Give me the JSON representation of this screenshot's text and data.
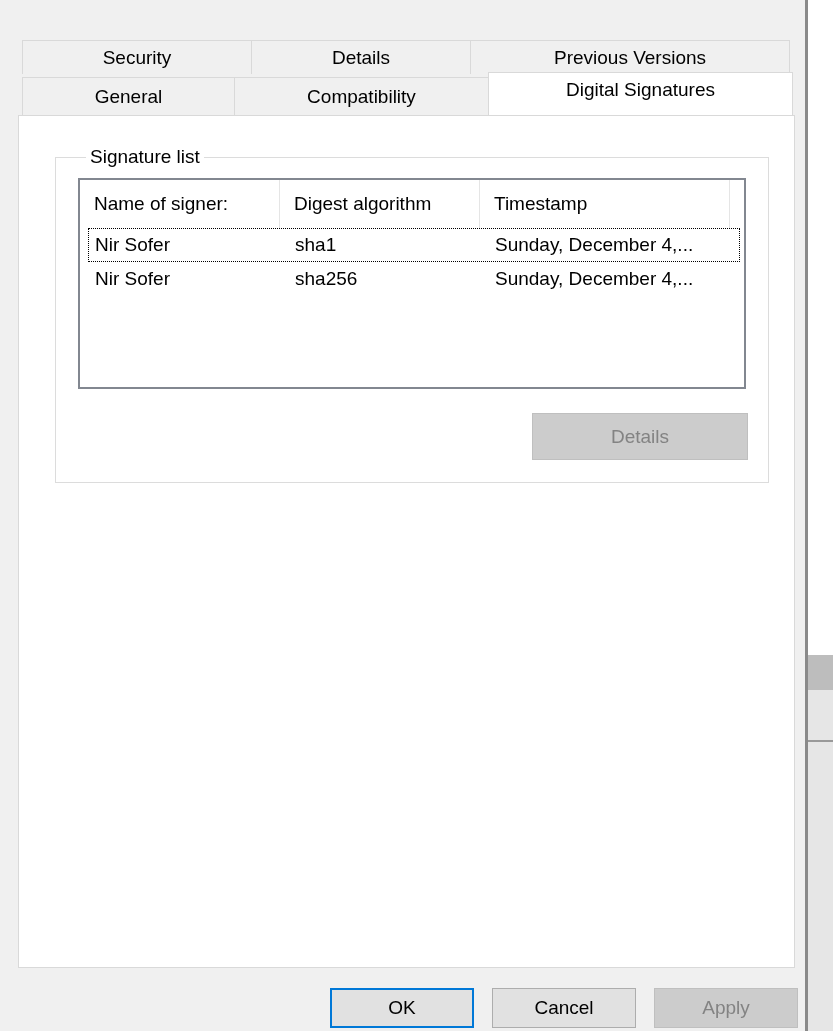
{
  "tabs": {
    "rows": [
      [
        {
          "label": "Security",
          "selected": false
        },
        {
          "label": "Details",
          "selected": false
        },
        {
          "label": "Previous Versions",
          "selected": false
        }
      ],
      [
        {
          "label": "General",
          "selected": false
        },
        {
          "label": "Compatibility",
          "selected": false
        },
        {
          "label": "Digital Signatures",
          "selected": true
        }
      ]
    ]
  },
  "signature_list": {
    "title": "Signature list",
    "columns": [
      "Name of signer:",
      "Digest algorithm",
      "Timestamp"
    ],
    "rows": [
      {
        "cells": [
          "Nir Sofer",
          "sha1",
          "Sunday, December 4,..."
        ],
        "selected": true
      },
      {
        "cells": [
          "Nir Sofer",
          "sha256",
          "Sunday, December 4,..."
        ],
        "selected": false
      }
    ],
    "details_button": {
      "label": "Details",
      "disabled": true
    }
  },
  "buttons": [
    {
      "label": "OK",
      "default": true,
      "disabled": false
    },
    {
      "label": "Cancel",
      "default": false,
      "disabled": false
    },
    {
      "label": "Apply",
      "default": false,
      "disabled": true
    }
  ]
}
